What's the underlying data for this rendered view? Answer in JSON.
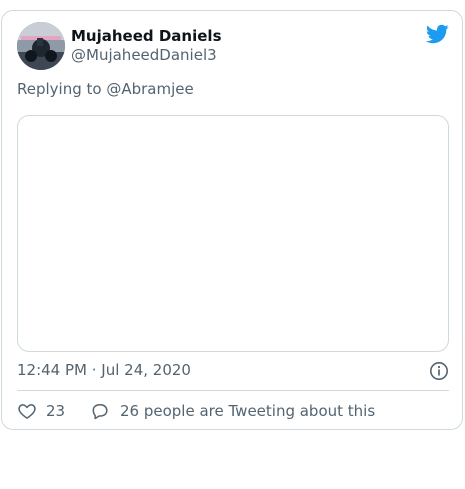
{
  "tweet": {
    "author_name": "Mujaheed Daniels",
    "author_handle": "@MujaheedDaniel3",
    "replying_prefix": "Replying to ",
    "replying_to": "@Abramjee",
    "timestamp": "12:44 PM · Jul 24, 2020",
    "likes": "23",
    "conversation_text": "26 people are Tweeting about this"
  },
  "icons": {
    "brand": "twitter-bird-icon",
    "info": "info-icon",
    "like": "heart-icon",
    "reply": "speech-bubble-icon"
  },
  "colors": {
    "brand": "#1d9bf0",
    "text_primary": "#0f1419",
    "text_secondary": "#536471",
    "border": "#cfd9de"
  }
}
